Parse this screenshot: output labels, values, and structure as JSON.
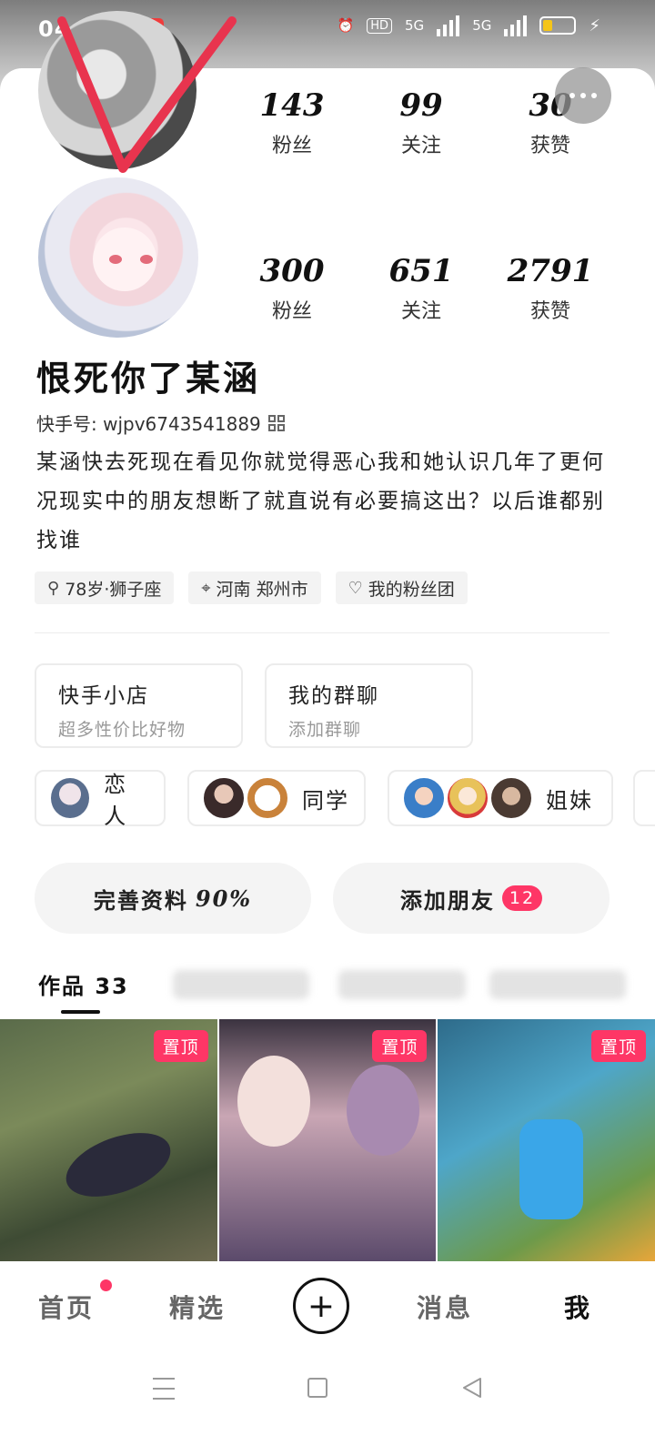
{
  "status_bar": {
    "time": "04:32",
    "hd_badge": "HD",
    "signal1": "5G",
    "signal2": "5G"
  },
  "stats_top": [
    {
      "num": "143",
      "label": "粉丝"
    },
    {
      "num": "99",
      "label": "关注"
    },
    {
      "num": "30",
      "label": "获赞"
    }
  ],
  "stats": [
    {
      "num": "300",
      "label": "粉丝"
    },
    {
      "num": "651",
      "label": "关注"
    },
    {
      "num": "2791",
      "label": "获赞"
    }
  ],
  "profile": {
    "name": "恨死你了某涵",
    "kuaishou_id": "快手号: wjpv6743541889",
    "bio": "某涵快去死现在看见你就觉得恶心我和她认识几年了更何况现实中的朋友想断了就直说有必要搞这出？以后谁都别找谁"
  },
  "tags": [
    {
      "icon": "gender-icon",
      "label": "78岁·狮子座"
    },
    {
      "icon": "location-pin-icon",
      "label": "河南 郑州市"
    },
    {
      "icon": "heart-icon",
      "label": "我的粉丝团"
    }
  ],
  "cards": [
    {
      "title": "快手小店",
      "subtitle": "超多性价比好物"
    },
    {
      "title": "我的群聊",
      "subtitle": "添加群聊"
    }
  ],
  "groups": [
    {
      "label": "恋人"
    },
    {
      "label": "同学"
    },
    {
      "label": "姐妹"
    }
  ],
  "actions": {
    "complete_label": "完善资料",
    "complete_pct": "90%",
    "add_friend_label": "添加朋友",
    "add_friend_count": "12"
  },
  "tabs": {
    "works_label": "作品 33"
  },
  "grid": {
    "pin_label": "置顶"
  },
  "bottom_nav": [
    {
      "label": "首页"
    },
    {
      "label": "精选"
    },
    {
      "label": "消息"
    },
    {
      "label": "我"
    }
  ],
  "colors": {
    "accent": "#fe3666",
    "annotation_mark": "#e8344e"
  }
}
